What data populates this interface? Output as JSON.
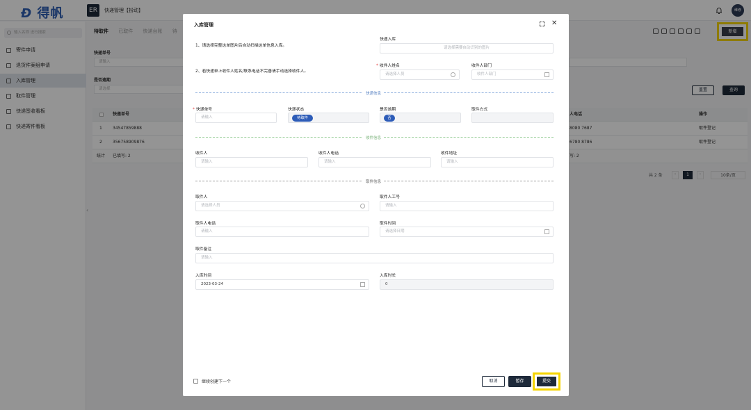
{
  "topbar": {
    "logo": "得帆",
    "app_icon_text": "ER",
    "app_title": "快递管理【扮动】",
    "avatar_text": "维修"
  },
  "sidebar": {
    "search_placeholder": "输入名称 进行搜索",
    "items": [
      {
        "label": "寄件申请"
      },
      {
        "label": "退货件案组申请"
      },
      {
        "label": "入库管理",
        "active": true
      },
      {
        "label": "取件管理"
      },
      {
        "label": "快递签收看板"
      },
      {
        "label": "快递寄件看板"
      }
    ]
  },
  "main": {
    "tabs": [
      "待取件",
      "已取件",
      "快递台账",
      "待"
    ],
    "new_button": "新增",
    "filters": {
      "tracking_label": "快递单号",
      "tracking_placeholder": "请输入",
      "overdue_label": "是否逾期",
      "overdue_placeholder": "请选择"
    },
    "reset_button": "重置",
    "query_button": "查询",
    "table": {
      "headers": {
        "no": "快递单号",
        "phone": "人电话",
        "action": "操作"
      },
      "rows": [
        {
          "index": "1",
          "no": "34547859888",
          "phone": "8080 7687",
          "action": "取件登记"
        },
        {
          "index": "2",
          "no": "356758909876",
          "phone": "6780 8786",
          "action": "取件登记"
        }
      ],
      "footer": {
        "label": "统计",
        "filled": "已填写: 2",
        "right": "写: 2"
      }
    },
    "pager": {
      "total": "共 2 条",
      "page": "1",
      "size": "10条/页"
    }
  },
  "modal": {
    "title": "入库管理",
    "note1": "1、请选择完整这单图片后自动扫描这单信息入库。",
    "note2": "2、若快递单上收件人姓名/联系电话不完善请手动选择收件人。",
    "express_in_label": "快递入库",
    "express_in_placeholder": "请选择需要自动识别的图片",
    "recipient_name_label": "收件人姓名",
    "recipient_name_placeholder": "请选择人员",
    "recipient_dept_label": "收件人部门",
    "recipient_dept_placeholder": "收件人部门",
    "section_express": "快递信息",
    "tracking_label": "快递单号",
    "tracking_placeholder": "请输入",
    "status_label": "快递状态",
    "status_value": "待取件",
    "overdue_label": "是否逾期",
    "overdue_value": "否",
    "pickup_method_label": "取件方式",
    "section_recipient": "收件信息",
    "recipient_label": "收件人",
    "recipient_placeholder": "请输入",
    "recipient_phone_label": "收件人电话",
    "recipient_phone_placeholder": "请输入",
    "recipient_addr_label": "收件地址",
    "recipient_addr_placeholder": "请输入",
    "section_pickup": "取件信息",
    "picker_label": "取件人",
    "picker_placeholder": "请选择人员",
    "picker_id_label": "取件人工号",
    "picker_id_placeholder": "请输入",
    "picker_phone_label": "取件人电话",
    "picker_phone_placeholder": "请输入",
    "pickup_time_label": "取件时间",
    "pickup_time_placeholder": "请选择日期",
    "pickup_note_label": "取件备注",
    "pickup_note_placeholder": "请输入",
    "in_time_label": "入库时间",
    "in_time_value": "2023-03-24",
    "in_duration_label": "入库时长",
    "in_duration_value": "0",
    "continue_label": "继续创建下一个",
    "cancel_button": "取消",
    "save_button": "暂存",
    "submit_button": "提交"
  },
  "colors": {
    "primary": "#1e2a3a",
    "tag_blue": "#2d5cb8",
    "highlight": "#f5d400",
    "required": "#e54545"
  }
}
